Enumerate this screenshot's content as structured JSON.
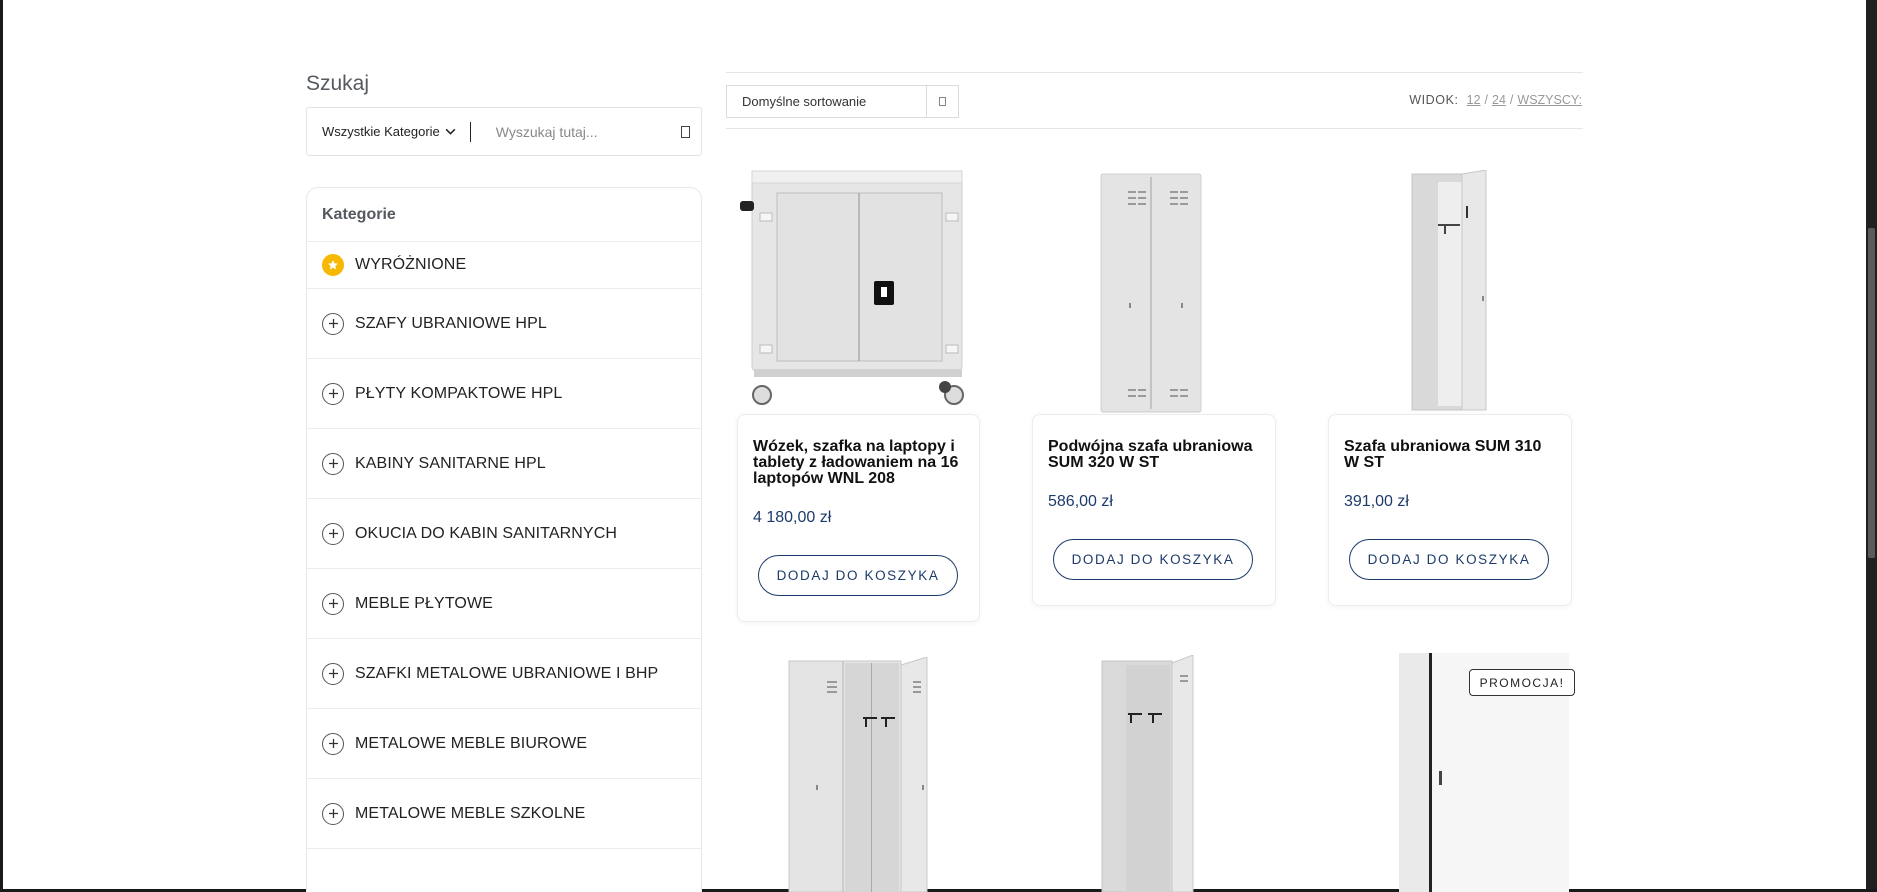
{
  "sidebar": {
    "search_title": "Szukaj",
    "category_select": "Wszystkie Kategorie",
    "search_placeholder": "Wyszukaj tutaj...",
    "categories_heading": "Kategorie",
    "categories": [
      {
        "label": "WYRÓŻNIONE",
        "icon": "star-icon"
      },
      {
        "label": "SZAFY UBRANIOWE HPL",
        "icon": "plus-icon"
      },
      {
        "label": "PŁYTY KOMPAKTOWE HPL",
        "icon": "plus-icon"
      },
      {
        "label": "KABINY SANITARNE HPL",
        "icon": "plus-icon"
      },
      {
        "label": "OKUCIA DO KABIN SANITARNYCH",
        "icon": "plus-icon"
      },
      {
        "label": "MEBLE PŁYTOWE",
        "icon": "plus-icon"
      },
      {
        "label": "SZAFKI METALOWE UBRANIOWE I BHP",
        "icon": "plus-icon"
      },
      {
        "label": "METALOWE MEBLE BIUROWE",
        "icon": "plus-icon"
      },
      {
        "label": "METALOWE MEBLE SZKOLNE",
        "icon": "plus-icon"
      }
    ]
  },
  "toolbar": {
    "sort_label": "Domyślne sortowanie",
    "view_label": "WIDOK:",
    "view_options": [
      "12",
      "24",
      "WSZYSCY:"
    ],
    "view_sep": "/"
  },
  "products": [
    {
      "title": "Wózek, szafka na laptopy i tablety z ładowaniem na 16 laptopów WNL 208",
      "price": "4 180,00 zł",
      "button": "DODAJ DO KOSZYKA"
    },
    {
      "title": "Podwójna szafa ubraniowa SUM 320 W ST",
      "price": "586,00 zł",
      "button": "DODAJ DO KOSZYKA"
    },
    {
      "title": "Szafa ubraniowa SUM 310 W ST",
      "price": "391,00 zł",
      "button": "DODAJ DO KOSZYKA"
    }
  ],
  "promo_badge": "PROMOCJA!",
  "colors": {
    "accent": "#1d3b6a",
    "star": "#f6b800",
    "cabinet": "#e4e4e4"
  }
}
